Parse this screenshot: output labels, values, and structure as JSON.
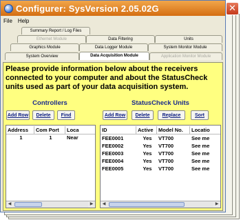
{
  "window": {
    "title": "Configurer:  SysVersion 2.05.02G",
    "close_glyph": "✕"
  },
  "menu": [
    "File",
    "Help"
  ],
  "tabs": {
    "row1": [
      "Summary Report / Log Files"
    ],
    "row2": [
      "Ethernet Module",
      "Data Filtering",
      "Units"
    ],
    "row3": [
      "Graphics Module",
      "Data Logger Module",
      "System Monitor Module"
    ],
    "row4": [
      "System Overview",
      "Data Acquisition Module",
      "Application Monitor Module"
    ],
    "active": "Data Acquisition Module"
  },
  "prompt": "Please provide information below about the receivers connected to your computer and about the StatusCheck units used as part of your data acquisition system.",
  "controllers": {
    "title": "Controllers",
    "buttons": [
      "Add Row",
      "Delete",
      "Find"
    ],
    "columns": [
      "Address",
      "Com Port",
      "Loca"
    ],
    "rows": [
      [
        "1",
        "1",
        "Near"
      ]
    ]
  },
  "units": {
    "title": "StatusCheck Units",
    "buttons": [
      "Add Row",
      "Delete",
      "Replace",
      "Sort"
    ],
    "columns": [
      "ID",
      "Active",
      "Model No.",
      "Locatio"
    ],
    "rows": [
      [
        "FEE0001",
        "Yes",
        "VT700",
        "See me"
      ],
      [
        "FEE0002",
        "Yes",
        "VT700",
        "See me"
      ],
      [
        "FEE0003",
        "Yes",
        "VT700",
        "See me"
      ],
      [
        "FEE0004",
        "Yes",
        "VT700",
        "See me"
      ],
      [
        "FEE0005",
        "Yes",
        "VT700",
        "See me"
      ]
    ]
  },
  "colors": {
    "title_bar": "#e07c1f",
    "content_bg": "#ffff80",
    "panel_title": "#1a2b8c"
  }
}
